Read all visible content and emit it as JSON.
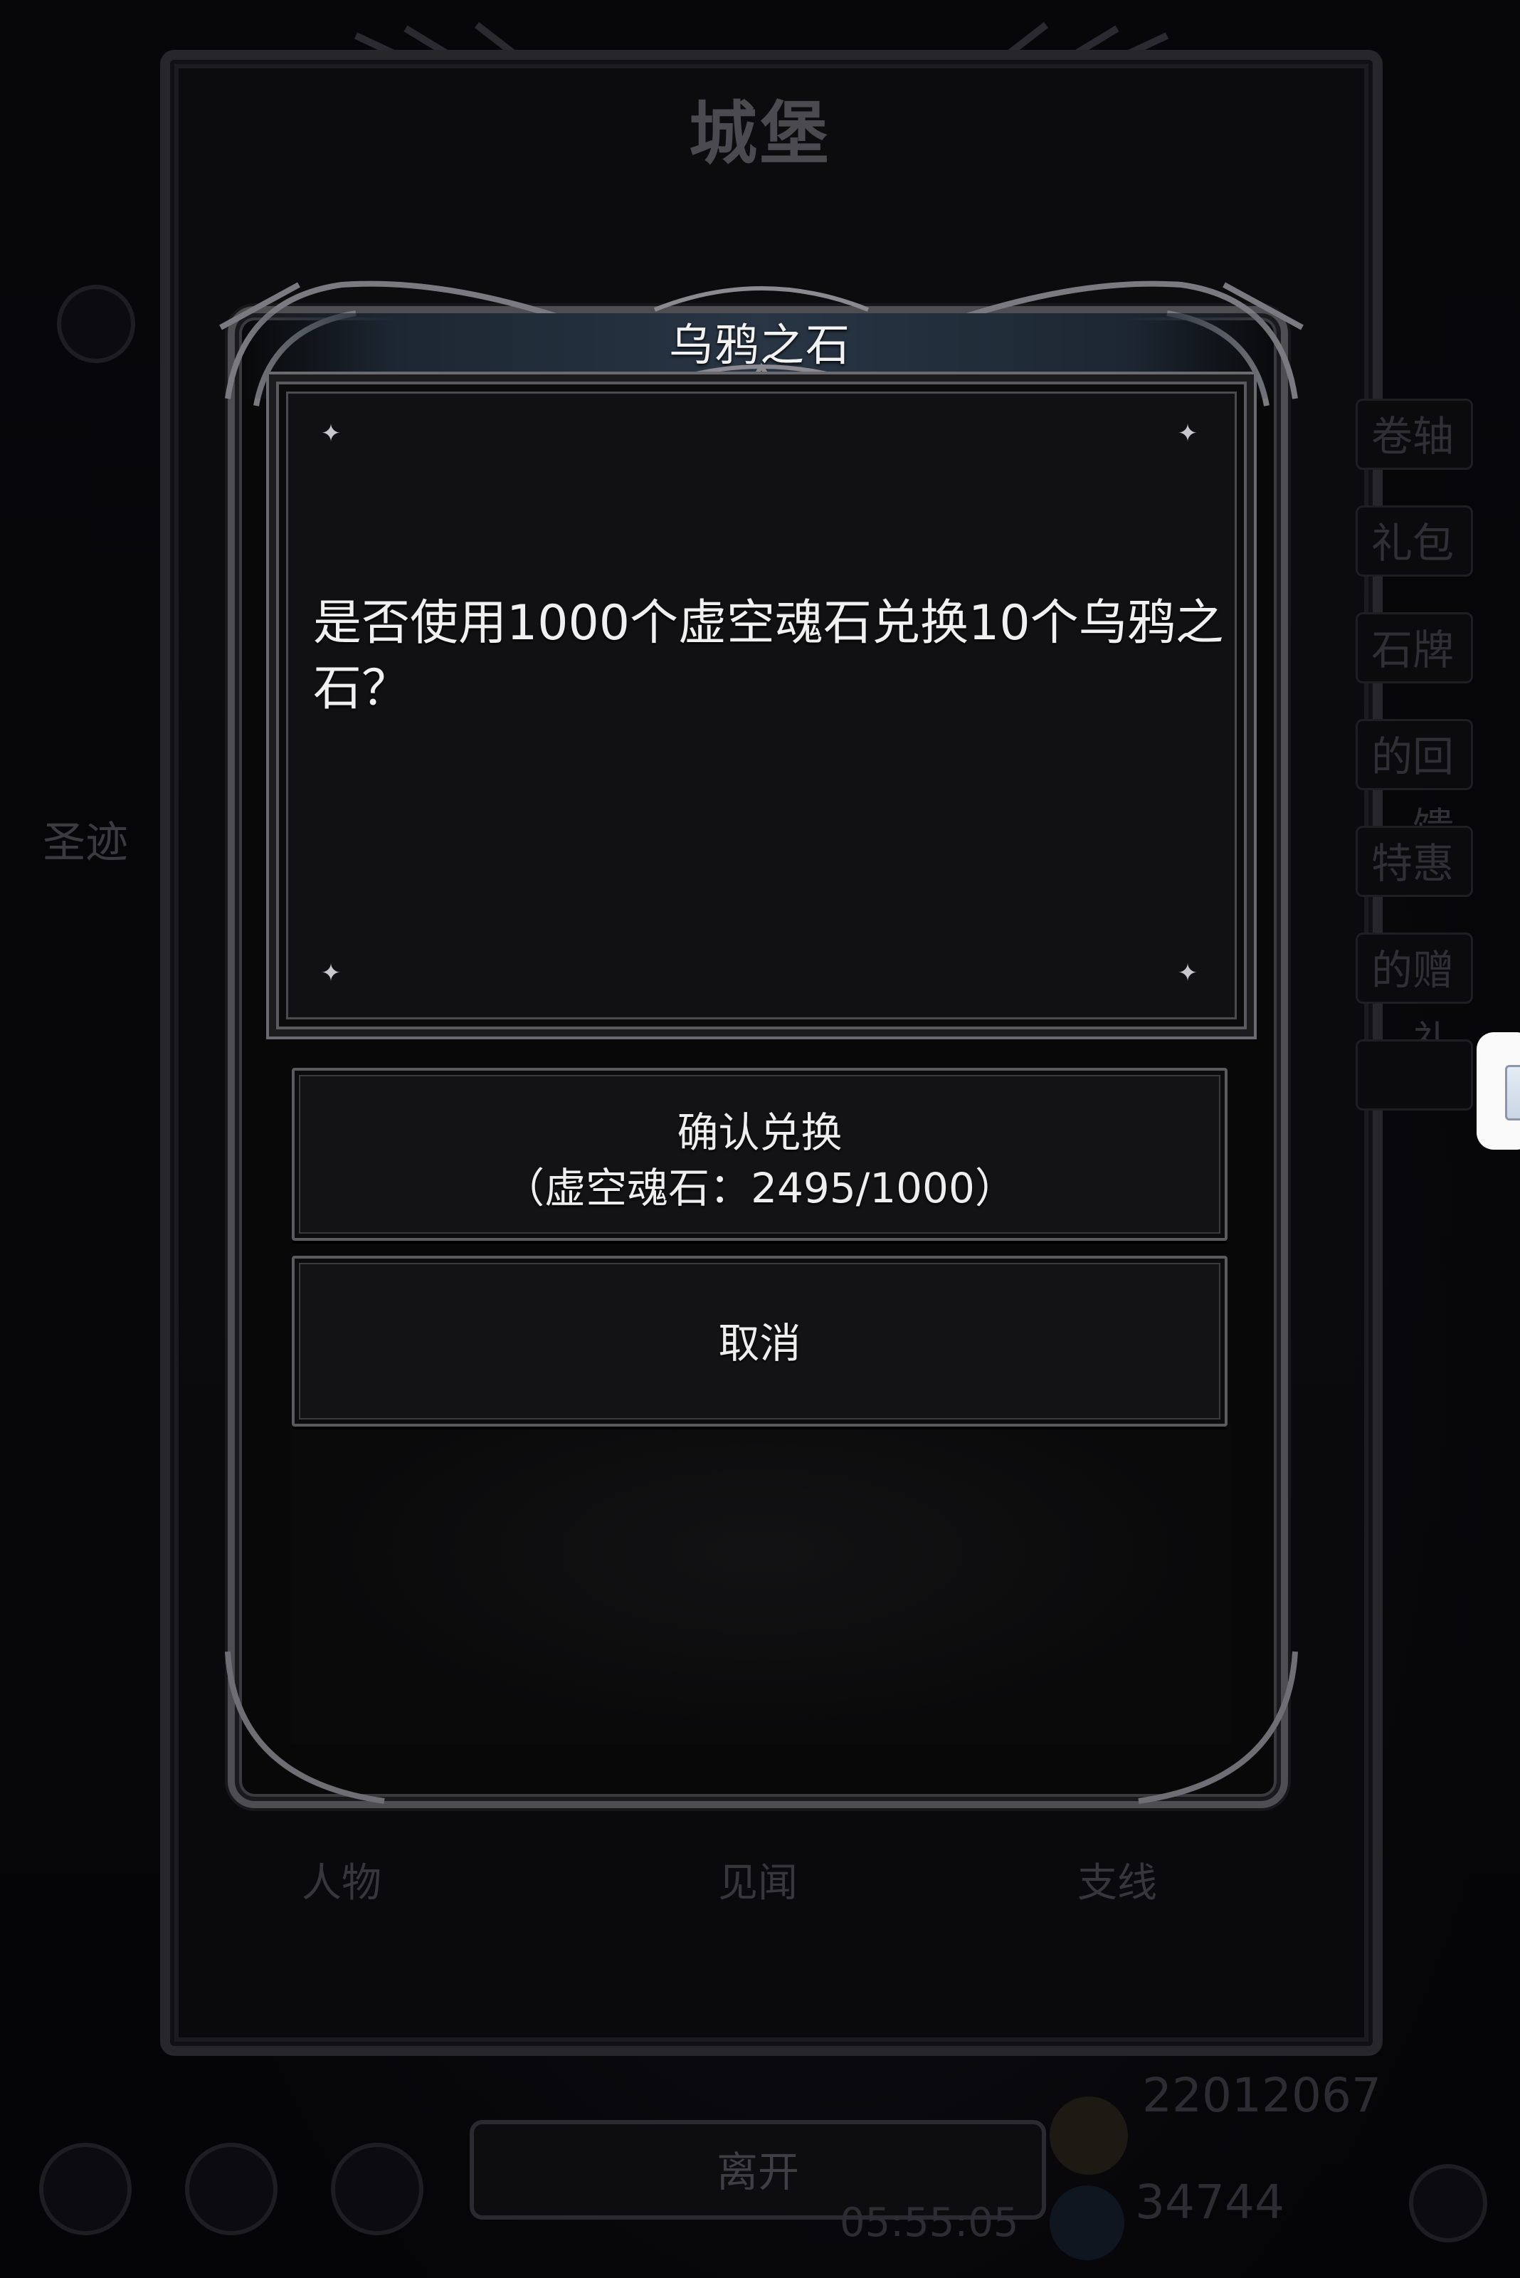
{
  "background": {
    "castle_title": "城堡",
    "left_label": "圣迹",
    "side_tabs": [
      "卷轴",
      "礼包",
      "石牌",
      "的回馈",
      "特惠",
      "的赠礼"
    ],
    "tabs": [
      "人物",
      "见闻",
      "支线"
    ],
    "leave_label": "离开",
    "gold_amount": "22012067",
    "gem_amount": "34744",
    "timer": "05:55:05"
  },
  "dialog": {
    "title": "乌鸦之石",
    "message": "是否使用1000个虚空魂石兑换10个乌鸦之石？",
    "confirm_label": "确认兑换",
    "confirm_cost": "（虚空魂石：2495/1000）",
    "cancel_label": "取消"
  }
}
